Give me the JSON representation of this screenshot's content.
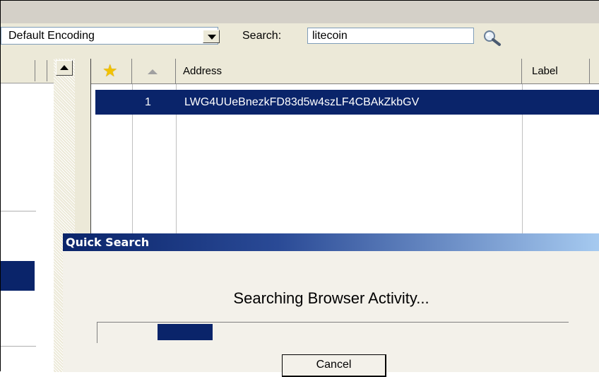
{
  "toolbar": {
    "encoding_value": "Default Encoding",
    "search_label": "Search:",
    "search_value": "litecoin"
  },
  "grid": {
    "headers": {
      "address": "Address",
      "label": "Label"
    },
    "rows": [
      {
        "index": "1",
        "address": "LWG4UUeBnezkFD83d5w4szLF4CBAkZkbGV"
      }
    ]
  },
  "dialog": {
    "title": "Quick Search",
    "message": "Searching Browser Activity...",
    "cancel_label": "Cancel"
  },
  "colors": {
    "selection": "#0a246a",
    "chrome": "#ece9d8"
  }
}
